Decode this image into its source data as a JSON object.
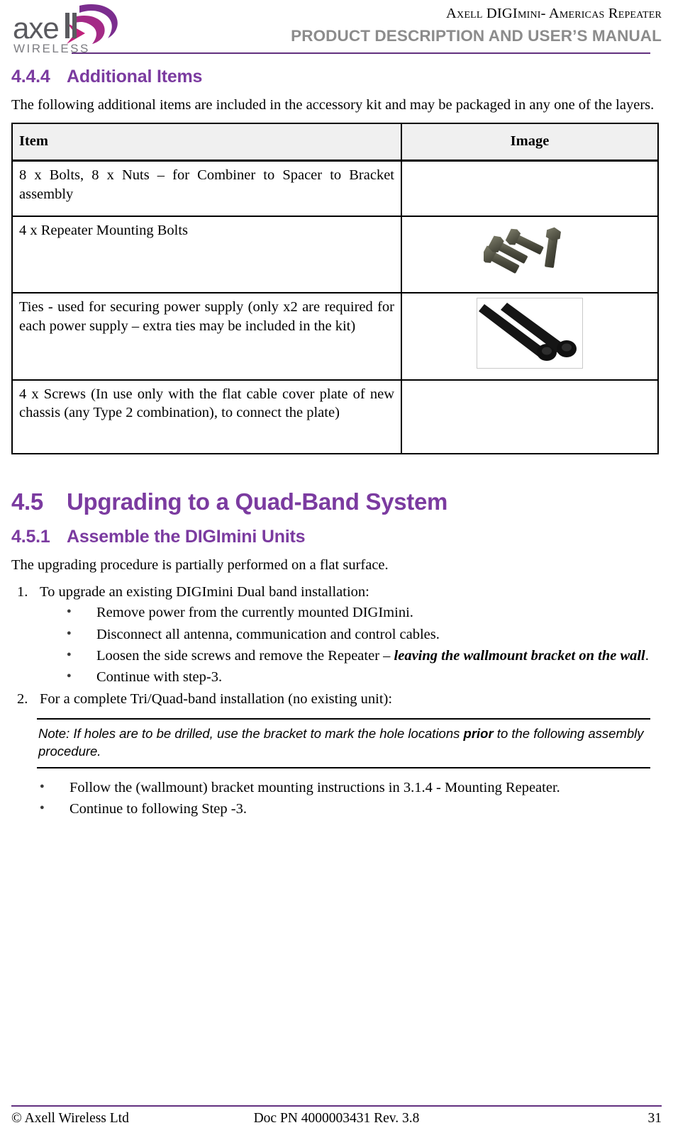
{
  "header": {
    "logo": {
      "wordmark": "axell",
      "subtext": "WIRELESS",
      "icon": "axell-swoosh-icon"
    },
    "title_line1": "Axell DIGImini- Americas Repeater",
    "title_line2": "PRODUCT DESCRIPTION AND USER’S MANUAL",
    "accent_color": "#62307f",
    "title2_color": "#8c8c8c"
  },
  "sections": {
    "s444": {
      "number": "4.4.4",
      "title": "Additional Items",
      "intro": "The following additional items are included in the accessory kit and may be packaged in any one of the layers."
    },
    "s45": {
      "number": "4.5",
      "title": "Upgrading to a Quad-Band System"
    },
    "s451": {
      "number": "4.5.1",
      "title": "Assemble the DIGImini Units",
      "intro": "The upgrading procedure is partially performed on a flat surface."
    }
  },
  "table": {
    "headers": [
      "Item",
      "Image"
    ],
    "rows": [
      {
        "item": "8 x Bolts, 8 x Nuts – for Combiner to Spacer to Bracket assembly",
        "image": "none"
      },
      {
        "item": "4 x Repeater Mounting Bolts",
        "image": "bolts-photo"
      },
      {
        "item": "Ties  - used for securing power supply (only x2 are required for each power supply – extra ties may be included in the kit)",
        "image": "cable-ties-photo"
      },
      {
        "item": "4 x Screws (In use only with the flat cable cover plate of new chassis (any Type 2 combination), to connect the plate)",
        "image": "none"
      }
    ]
  },
  "procedure": {
    "step1": {
      "marker": "1.",
      "text": "To upgrade an existing DIGImini Dual band installation:",
      "bullets": [
        {
          "pre": "Remove power from the currently mounted DIGImini.",
          "emph": "",
          "post": ""
        },
        {
          "pre": "Disconnect all antenna, communication and control cables.",
          "emph": "",
          "post": ""
        },
        {
          "pre": "Loosen the side screws and remove the Repeater – ",
          "emph": "leaving the wallmount bracket on the wall",
          "post": "."
        },
        {
          "pre": "Continue with step-3.",
          "emph": "",
          "post": ""
        }
      ]
    },
    "step2": {
      "marker": "2.",
      "text": "For a complete Tri/Quad-band installation (no existing unit):",
      "note": {
        "pre": "Note: If holes are to be drilled, use the bracket to mark the hole locations ",
        "emph": "prior",
        "post": " to the following assembly procedure."
      },
      "bullets": [
        {
          "pre": "Follow the (wallmount) bracket mounting instructions in 3.1.4 - Mounting Repeater.",
          "emph": "",
          "post": ""
        },
        {
          "pre": "Continue to following Step -3.",
          "emph": "",
          "post": ""
        }
      ]
    }
  },
  "footer": {
    "copyright": "© Axell Wireless Ltd",
    "doc_info": "Doc PN 4000003431 Rev. 3.8",
    "page_number": "31"
  }
}
